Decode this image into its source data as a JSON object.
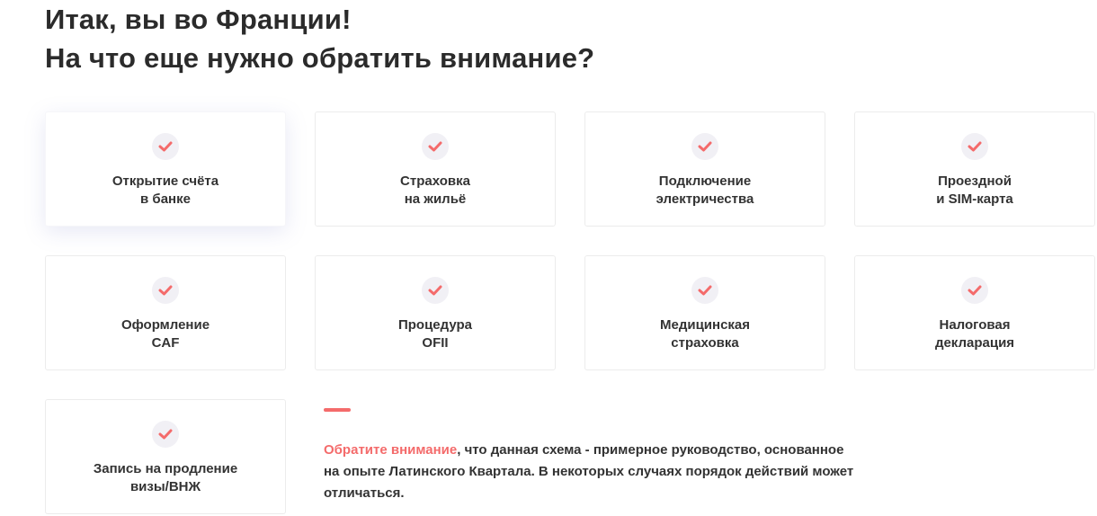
{
  "heading": {
    "line1": "Итак, вы во Франции!",
    "line2": "На что еще нужно обратить внимание?"
  },
  "colors": {
    "accent": "#f46b6b",
    "check_bg": "#f1f0f5",
    "text": "#333333"
  },
  "cards": [
    {
      "line1": "Открытие счёта",
      "line2": "в банке",
      "icon": "check-icon",
      "active": true
    },
    {
      "line1": "Страховка",
      "line2": "на жильё",
      "icon": "check-icon"
    },
    {
      "line1": "Подключение",
      "line2": "электричества",
      "icon": "check-icon"
    },
    {
      "line1": "Проездной",
      "line2": "и SIM-карта",
      "icon": "check-icon"
    },
    {
      "line1": "Оформление",
      "line2": "CAF",
      "icon": "check-icon"
    },
    {
      "line1": "Процедура",
      "line2": "OFII",
      "icon": "check-icon"
    },
    {
      "line1": "Медицинская",
      "line2": "страховка",
      "icon": "check-icon"
    },
    {
      "line1": "Налоговая",
      "line2": "декларация",
      "icon": "check-icon"
    },
    {
      "line1": "Запись на продление",
      "line2": "визы/ВНЖ",
      "icon": "check-icon"
    }
  ],
  "note": {
    "highlight": "Обратите внимание",
    "line1_rest": ", что данная схема - примерное руководство, основанное",
    "line2": "на опыте Латинского Квартала. В некоторых случаях порядок действий может",
    "line3": "отличаться."
  }
}
